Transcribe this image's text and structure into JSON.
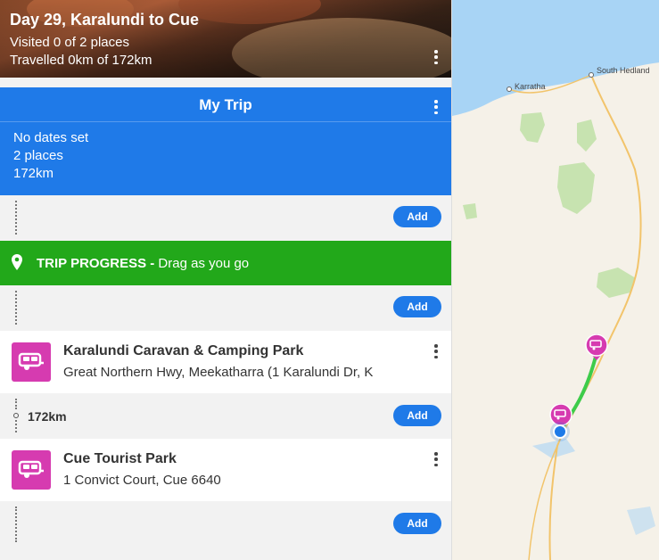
{
  "header": {
    "title": "Day 29, Karalundi to Cue",
    "visited": "Visited 0 of 2 places",
    "travelled": "Travelled 0km of 172km"
  },
  "trip": {
    "title": "My Trip",
    "dates": "No dates set",
    "places": "2 places",
    "distance": "172km"
  },
  "add_label": "Add",
  "progress": {
    "label": "TRIP PROGRESS -",
    "hint": "Drag as you go"
  },
  "places": [
    {
      "name": "Karalundi Caravan & Camping Park",
      "address": "Great Northern Hwy, Meekatharra (1 Karalundi Dr, K",
      "icon": "caravan-icon"
    },
    {
      "name": "Cue Tourist Park",
      "address": "1 Convict Court, Cue 6640",
      "icon": "caravan-icon"
    }
  ],
  "leg_distance": "172km",
  "map": {
    "labels": [
      "Karratha",
      "South Hedland"
    ],
    "colors": {
      "sea": "#a8d4f5",
      "land": "#f5f1e8",
      "park": "#c7e3b0",
      "road": "#f2c46b",
      "route": "#3dcc4a",
      "marker": "#d63bb0",
      "location": "#1f7ae8"
    }
  },
  "colors": {
    "trip_blue": "#1f7ae8",
    "progress_green": "#22a81a",
    "caravan_pink": "#d63bb0"
  }
}
